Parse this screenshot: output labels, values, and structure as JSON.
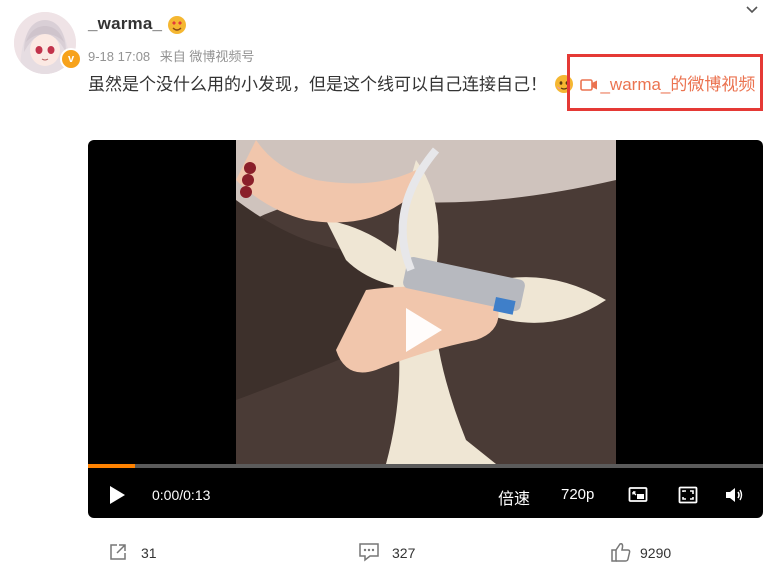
{
  "user": {
    "name": "_warma_",
    "timestamp": "9-18 17:08",
    "source": "来自 微博视频号",
    "verified_icon": "v"
  },
  "post": {
    "text": "虽然是个没什么用的小发现，但是这个线可以自己连接自己！",
    "link_text": "_warma_的微博视频"
  },
  "video": {
    "current_time": "0:00/0:13",
    "speed_label": "倍速",
    "quality_label": "720p",
    "progress": 0.07
  },
  "actions": {
    "share_count": "31",
    "comment_count": "327",
    "like_count": "9290"
  },
  "colors": {
    "link": "#eb7350",
    "accent": "#ff8200",
    "highlight_box": "#e53935"
  },
  "icons": [
    "chevron-down-icon",
    "verified-icon",
    "emoji-icon",
    "camera-icon",
    "play-icon",
    "picture-in-picture-icon",
    "fullscreen-icon",
    "volume-icon",
    "share-icon",
    "comment-icon",
    "like-icon"
  ]
}
